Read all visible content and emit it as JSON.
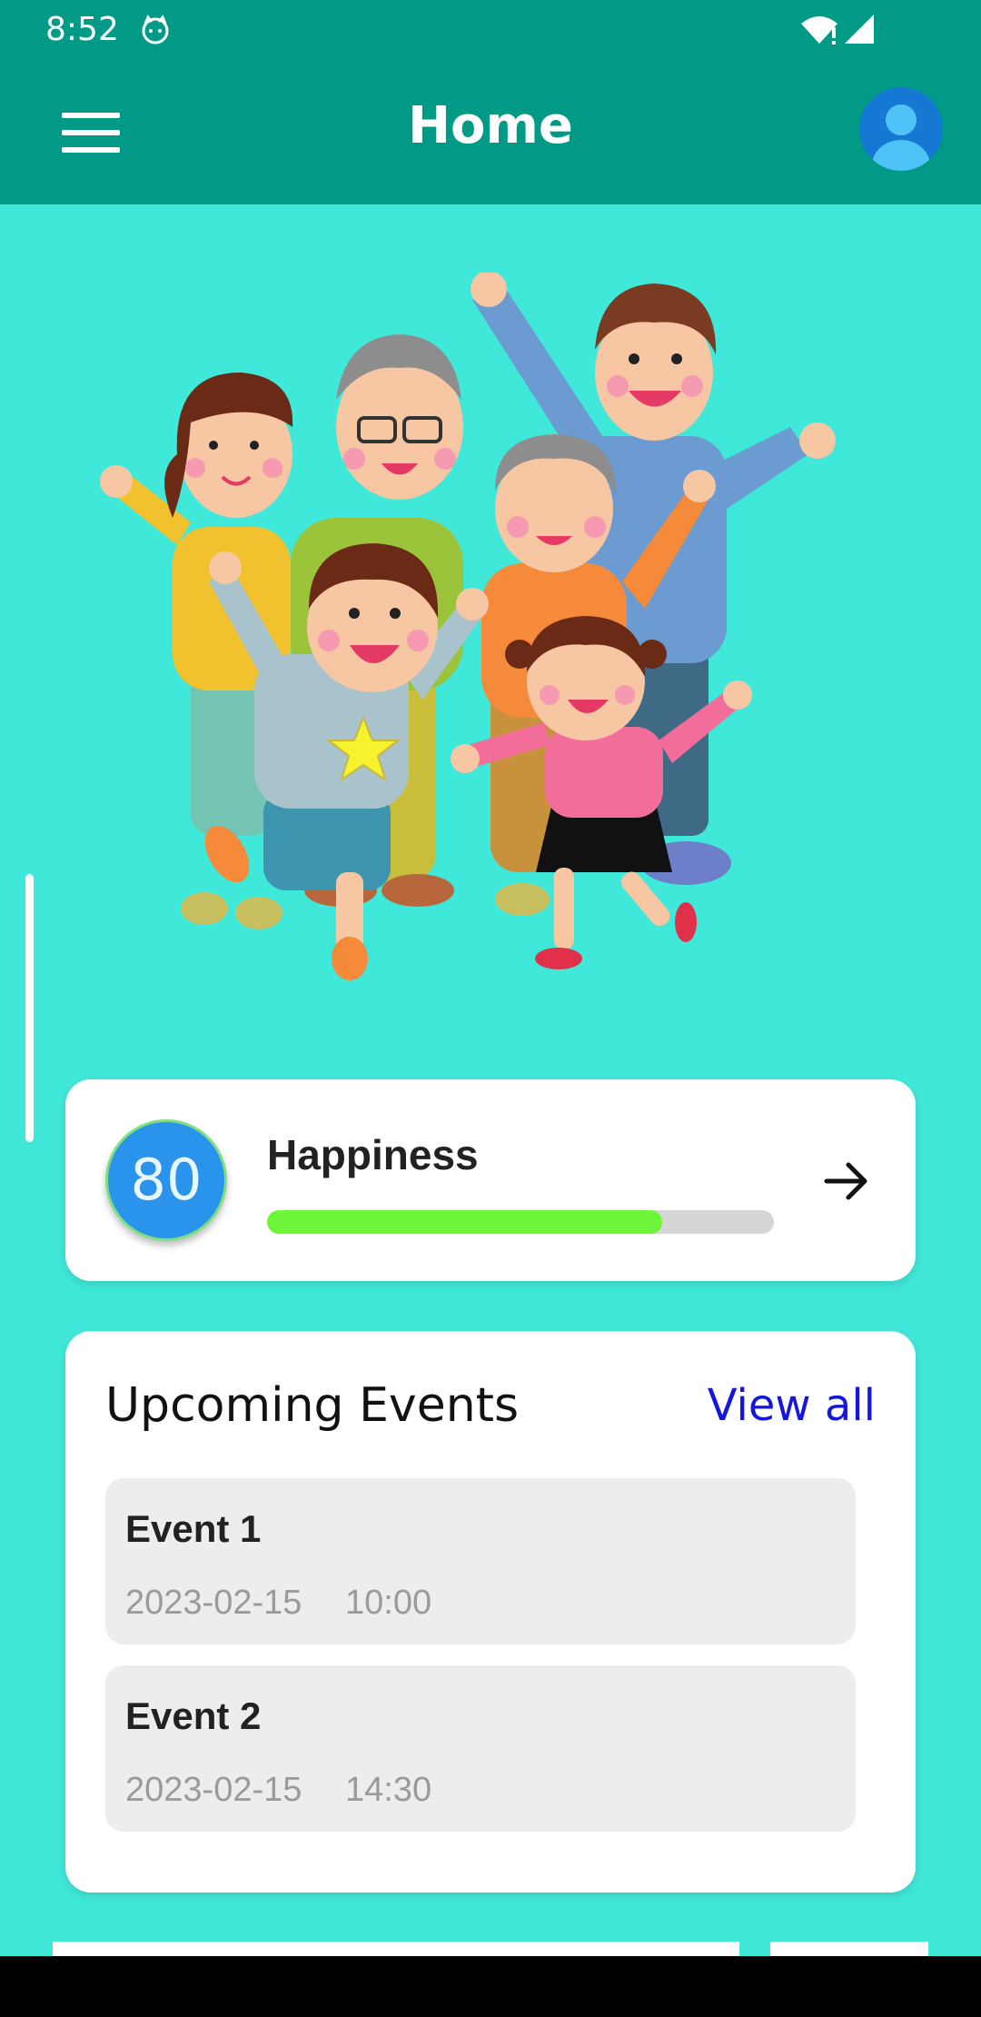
{
  "status_bar": {
    "time": "8:52",
    "icons": [
      "cat-icon",
      "wifi-icon",
      "signal-icon"
    ]
  },
  "app_bar": {
    "title": "Home",
    "menu_icon": "hamburger-menu-icon",
    "avatar_icon": "user-avatar-icon"
  },
  "hero": {
    "image": "family-illustration"
  },
  "happiness": {
    "score": "80",
    "label": "Happiness",
    "progress": 0.78,
    "arrow_icon": "arrow-right-icon"
  },
  "events": {
    "title": "Upcoming Events",
    "view_all": "View all",
    "items": [
      {
        "name": "Event 1",
        "date": "2023-02-15",
        "time": "10:00"
      },
      {
        "name": "Event 2",
        "date": "2023-02-15",
        "time": "14:30"
      }
    ]
  },
  "colors": {
    "app_bar": "#009A86",
    "background": "#40E8DA",
    "score_circle": "#2A93EC",
    "progress_fill": "#6DF539",
    "link": "#1515DC"
  }
}
